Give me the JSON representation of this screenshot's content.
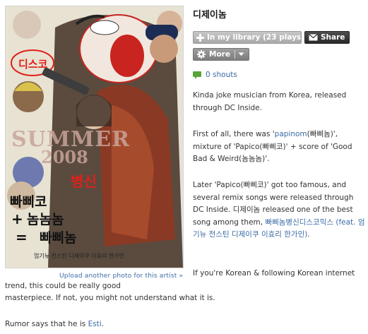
{
  "artist": {
    "name": "디제이놈"
  },
  "photo": {
    "alt_text": "Artist photo collage",
    "poster_texts": [
      "디스코",
      "SUMMER",
      "2008",
      "병신",
      "빠삐코",
      "+",
      "놈놈놈",
      "=",
      "빠삐놈",
      "엄기뉴 전스틴 디제이쿠 이효리 한가인"
    ],
    "upload_link": "Upload another photo for this artist »"
  },
  "buttons": {
    "library": "In my library (23 plays)",
    "share": "Share",
    "more": "More"
  },
  "shouts": {
    "label": "0 shouts"
  },
  "bio": {
    "p1": "Kinda joke musician from Korea, released through DC Inside.",
    "p2_pre": "First of all, there was '",
    "p2_link": "papinom",
    "p2_mid": "(빠삐놈)', mixture of 'Papico(빠삐코)' + score of 'Good Bad & Weird(놈놈놈)'.",
    "p3_pre": "Later 'Papico(빠삐코)' got too famous, and several remix songs were released through DC Inside. 디제이놈 released one of the best song among them, ",
    "p3_link": "빠삐놈병신디스코믹스 (feat. 엄기뉴 전스틴 디제이쿠 이효리 한가인)",
    "p3_post": ".",
    "p4_line1": "If you're Korean & following Korean internet",
    "p4_line2": "trend, this could be really good",
    "p4_line3": "masterpiece. If not, you might not understand what it is.",
    "p5_pre": "Rumor says that he is ",
    "p5_link": "Esti",
    "p5_post": "."
  },
  "icons": {
    "library": "plus-icon",
    "share": "envelope-icon",
    "more": "gear-icon",
    "more_dropdown": "chevron-down-icon",
    "shouts": "speech-bubble-icon"
  },
  "colors": {
    "link": "#3a6ba5",
    "share_bg": "#333333",
    "library_bg": "#b3b3b3",
    "more_bg": "#8a8a8a",
    "shout_icon": "#5aa43a"
  }
}
